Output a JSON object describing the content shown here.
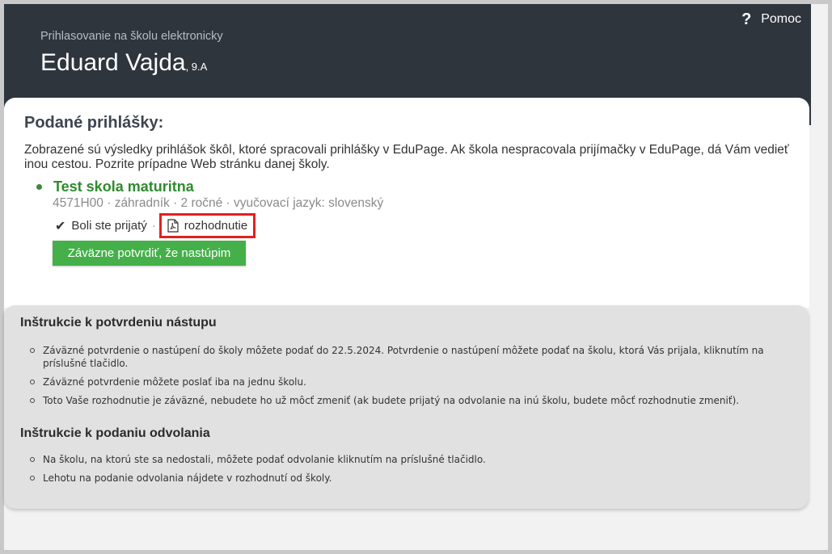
{
  "header": {
    "help_label": "Pomoc",
    "subtitle": "Prihlasovanie na školu elektronicky",
    "student_name": "Eduard Vajda",
    "student_class": ", 9.A"
  },
  "applications": {
    "title": "Podané prihlášky:",
    "description": "Zobrazené sú výsledky prihlášok škôl, ktoré spracovali prihlášky v EduPage. Ak škola nespracovala prijímačky v EduPage, dá Vám vedieť inou cestou. Pozrite prípadne Web stránku danej školy.",
    "school": {
      "name": "Test skola maturitna",
      "meta": "4571H00 · záhradník · 2 ročné · vyučovací jazyk: slovenský",
      "status": "Boli ste prijatý",
      "separator": "·",
      "document_link": "rozhodnutie",
      "confirm_button": "Záväzne potvrdiť, že nastúpim"
    }
  },
  "instructions_confirm": {
    "title": "Inštrukcie k potvrdeniu nástupu",
    "items": [
      "Záväzné potvrdenie o nastúpení do školy môžete podať do 22.5.2024. Potvrdenie o nastúpení môžete podať na školu, ktorá Vás prijala, kliknutím na príslušné tlačidlo.",
      "Záväzné potvrdenie môžete poslať iba na jednu školu.",
      "Toto Vaše rozhodnutie je záväzné, nebudete ho už môcť zmeniť (ak budete prijatý na odvolanie na inú školu, budete môcť rozhodnutie zmeniť)."
    ]
  },
  "instructions_appeal": {
    "title": "Inštrukcie k podaniu odvolania",
    "items": [
      "Na školu, na ktorú ste sa nedostali, môžete podať odvolanie kliknutím na príslušné tlačidlo.",
      "Lehotu na podanie odvolania nájdete v rozhodnutí od školy."
    ]
  },
  "colors": {
    "header_bg": "#2f353d",
    "accent_green": "#45b04a",
    "school_green": "#2e8b2e",
    "highlight_red": "#e02020"
  }
}
